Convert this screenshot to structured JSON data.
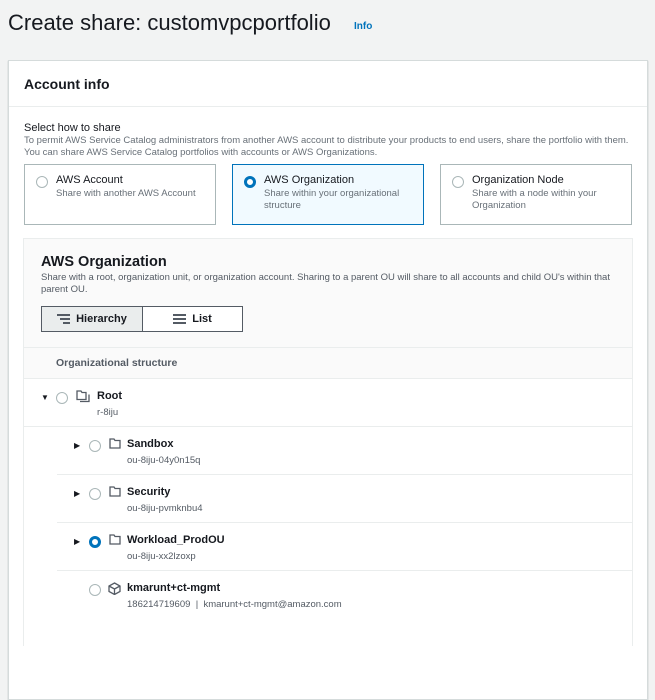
{
  "page": {
    "title": "Create share: customvpcportfolio",
    "info_link": "Info"
  },
  "panel": {
    "title": "Account info",
    "select_label": "Select how to share",
    "select_description": "To permit AWS Service Catalog administrators from another AWS account to distribute your products to end users, share the portfolio with them. You can share AWS Service Catalog portfolios with accounts or AWS Organizations.",
    "options": [
      {
        "title": "AWS Account",
        "description": "Share with another AWS Account",
        "selected": false
      },
      {
        "title": "AWS Organization",
        "description": "Share within your organizational structure",
        "selected": true
      },
      {
        "title": "Organization Node",
        "description": "Share with a node within your Organization",
        "selected": false
      }
    ]
  },
  "org": {
    "title": "AWS Organization",
    "description": "Share with a root, organization unit, or organization account. Sharing to a parent OU will share to all accounts and child OU's within that parent OU.",
    "view_toggle": {
      "hierarchy": "Hierarchy",
      "list": "List",
      "selected": "Hierarchy"
    },
    "column_header": "Organizational structure",
    "tree": [
      {
        "name": "Root",
        "id": "r-8iju",
        "type": "root",
        "expanded": true,
        "selected": false
      },
      {
        "name": "Sandbox",
        "id": "ou-8iju-04y0n15q",
        "type": "ou",
        "expanded": false,
        "selected": false
      },
      {
        "name": "Security",
        "id": "ou-8iju-pvmknbu4",
        "type": "ou",
        "expanded": false,
        "selected": false
      },
      {
        "name": "Workload_ProdOU",
        "id": "ou-8iju-xx2lzoxp",
        "type": "ou",
        "expanded": false,
        "selected": true
      },
      {
        "name": "kmarunt+ct-mgmt",
        "id": "186214719609",
        "email": "kmarunt+ct-mgmt@amazon.com",
        "separator": "|",
        "type": "account",
        "selected": false
      }
    ]
  },
  "colors": {
    "accent": "#0073bb",
    "background": "#f2f3f3"
  }
}
